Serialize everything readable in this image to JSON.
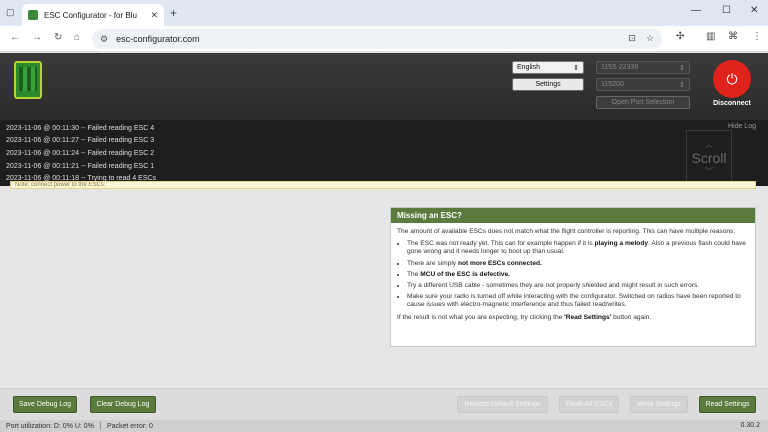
{
  "browser": {
    "tab_title": "ESC Configurator - for Blu",
    "tab_close": "✕",
    "new_tab": "+",
    "url": "esc-configurator.com",
    "win_min": "—",
    "win_max": "☐",
    "win_close": "✕"
  },
  "header": {
    "language": "English",
    "baud_top": "115S 22336",
    "baud": "115200",
    "settings_label": "Settings",
    "open_port_label": "Open Port Selection",
    "disconnect_label": "Disconnect"
  },
  "log": {
    "hide_label": "Hide Log",
    "scroll_label": "Scroll",
    "lines": [
      "2023-11-06 @ 00:11:30 -- Failed reading ESC 4",
      "2023-11-06 @ 00:11:27 -- Failed reading ESC 3",
      "2023-11-06 @ 00:11:24 -- Failed reading ESC 2",
      "2023-11-06 @ 00:11:21 -- Failed reading ESC 1",
      "2023-11-06 @ 00:11:18 -- Trying to read 4 ESCs"
    ],
    "notice": "Note: connect power to the ESCs."
  },
  "panel": {
    "title": "Missing an ESC?",
    "intro": "The amount of available ESCs does not match what the flight controller is reporting. This can have multiple reasons:",
    "items": [
      {
        "pre": "The ESC was not ready yet. This can for example happen if it is ",
        "bold": "playing a melody",
        "post": ". Also a previous flash could have gone wrong and it needs longer to boot up than usual."
      },
      {
        "pre": "There are simply ",
        "bold": "not more ESCs connected.",
        "post": ""
      },
      {
        "pre": "The ",
        "bold": "MCU of the ESC is defective.",
        "post": ""
      },
      {
        "pre": "Try a different USB cable - sometimes they are not properly shielded and might result in such errors.",
        "bold": "",
        "post": ""
      },
      {
        "pre": "Make sure your radio is turned off while interacting with the configurator. Switched on radios have been reported to cause issues with electro-magnetic interference and thus failed read/writes.",
        "bold": "",
        "post": ""
      }
    ],
    "outro_pre": "If the result is not what you are expecting, try clicking the ",
    "outro_bold": "'Read Settings'",
    "outro_post": " button again."
  },
  "footer": {
    "save_debug": "Save Debug Log",
    "clear_debug": "Clear Debug Log",
    "restore_defaults": "Restore Default Settings",
    "flash_all": "Flash All ESCs",
    "write_settings": "Write Settings",
    "read_settings": "Read Settings"
  },
  "status": {
    "port_util": "Port utilization: D: 0% U: 0%",
    "packet_error": "Packet error: 0",
    "version": "0.30.2"
  },
  "colors": {
    "accent": "#5a7a3e",
    "disconnect": "#e0221c"
  }
}
